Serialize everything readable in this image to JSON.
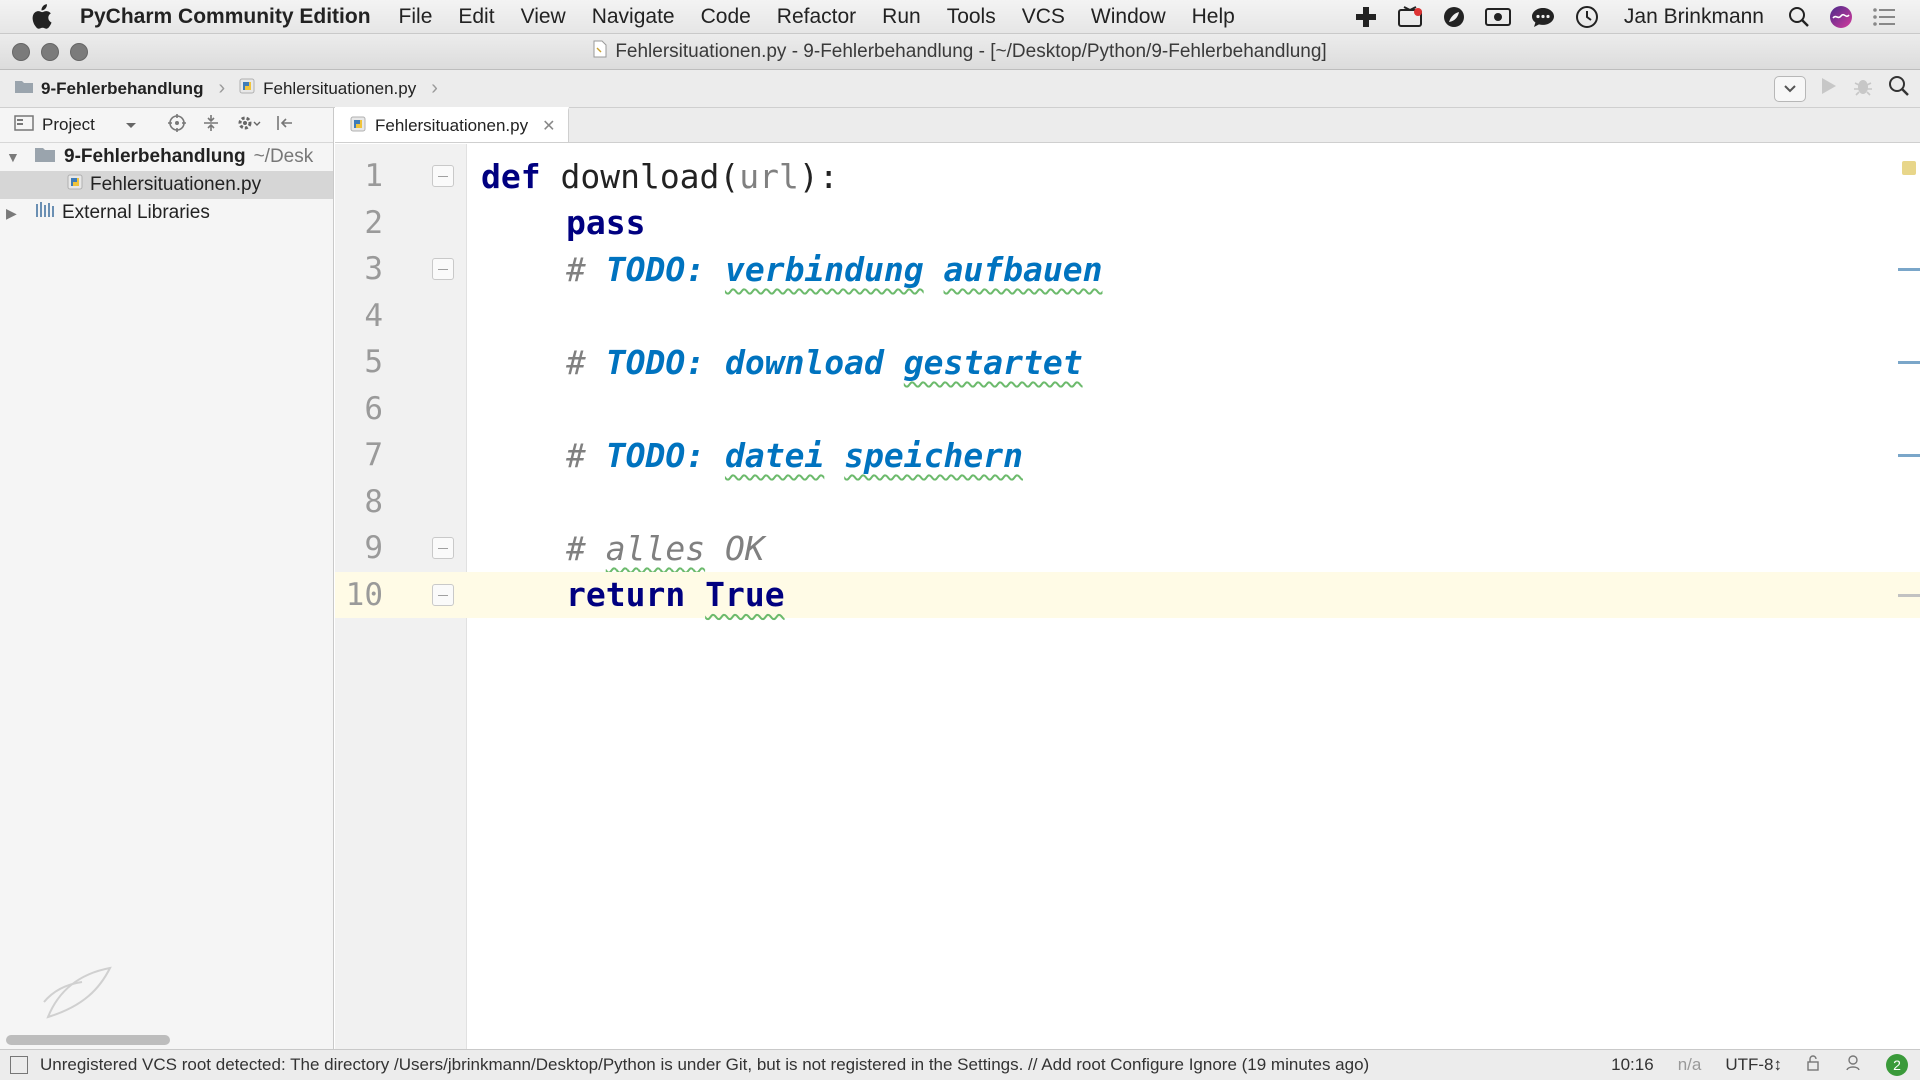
{
  "menubar": {
    "app_name": "PyCharm Community Edition",
    "items": [
      "File",
      "Edit",
      "View",
      "Navigate",
      "Code",
      "Refactor",
      "Run",
      "Tools",
      "VCS",
      "Window",
      "Help"
    ],
    "user": "Jan Brinkmann"
  },
  "window": {
    "title": "Fehlersituationen.py - 9-Fehlerbehandlung - [~/Desktop/Python/9-Fehlerbehandlung]"
  },
  "navbar": {
    "crumbs": [
      "9-Fehlerbehandlung",
      "Fehlersituationen.py"
    ]
  },
  "project_panel": {
    "header_label": "Project",
    "tree": [
      {
        "name": "9-Fehlerbehandlung",
        "path": "~/Desk",
        "type": "folder",
        "expanded": true
      },
      {
        "name": "Fehlersituationen.py",
        "type": "file",
        "selected": true
      },
      {
        "name": "External Libraries",
        "type": "library",
        "expanded": false
      }
    ]
  },
  "editor": {
    "tab_label": "Fehlersituationen.py",
    "lines": [
      {
        "num": "1",
        "kw": "def",
        "rest": " download(",
        "param": "url",
        "tail": "):"
      },
      {
        "num": "2",
        "kw": "pass"
      },
      {
        "num": "3",
        "hash": "# ",
        "todo_label": "TODO:",
        "todo_words": [
          "verbindung",
          "aufbauen"
        ]
      },
      {
        "num": "4"
      },
      {
        "num": "5",
        "hash": "# ",
        "todo_label": "TODO:",
        "todo_words": [
          "download",
          "gestartet"
        ]
      },
      {
        "num": "6"
      },
      {
        "num": "7",
        "hash": "# ",
        "todo_label": "TODO:",
        "todo_words": [
          "datei",
          "speichern"
        ]
      },
      {
        "num": "8"
      },
      {
        "num": "9",
        "hash": "# ",
        "comment_word": "alles",
        "comment_tail": " OK"
      },
      {
        "num": "10",
        "kw": "return",
        "kw2": "True"
      }
    ]
  },
  "statusbar": {
    "message": "Unregistered VCS root detected: The directory /Users/jbrinkmann/Desktop/Python is under Git, but is not registered in the Settings. // Add root  Configure  Ignore (19 minutes ago)",
    "position": "10:16",
    "na": "n/a",
    "encoding": "UTF-8↕",
    "notifications": "2"
  },
  "colors": {
    "keyword": "#000080",
    "todo": "#0073bf",
    "comment": "#808080",
    "current_line": "#fffbe6"
  }
}
